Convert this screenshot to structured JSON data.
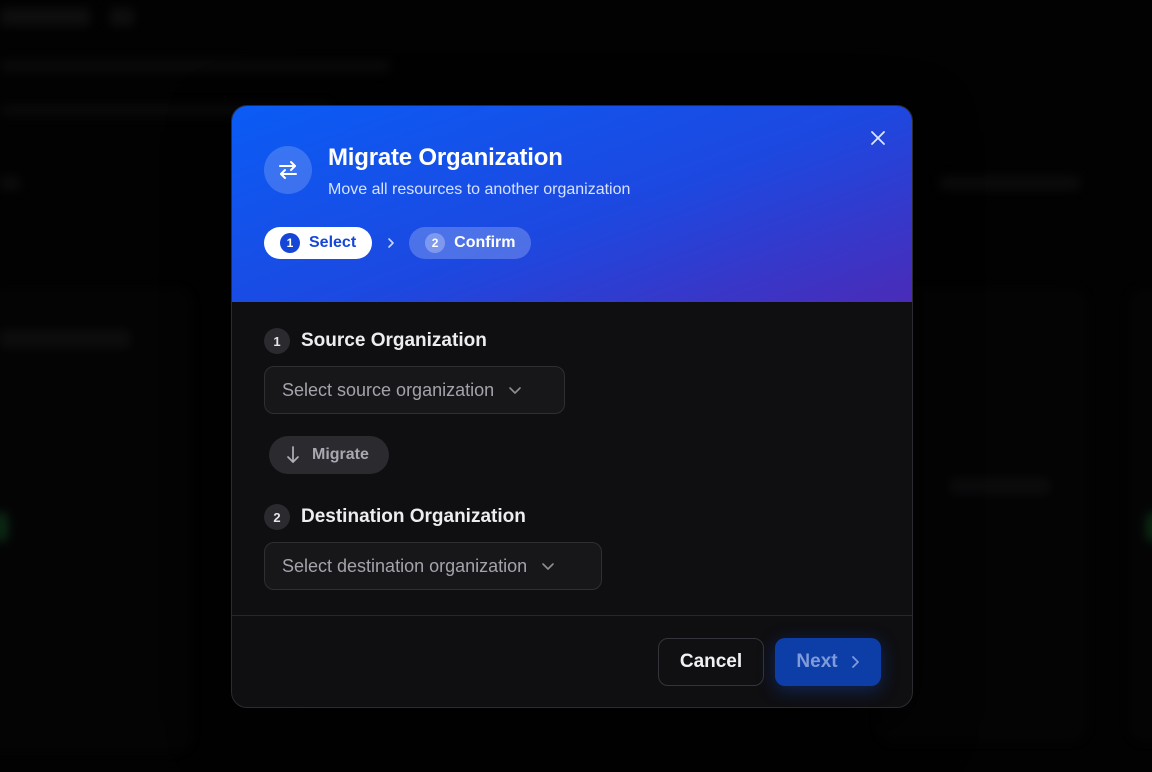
{
  "dialog": {
    "title": "Migrate Organization",
    "subtitle": "Move all resources to another organization",
    "header_icon": "swap-arrows-icon",
    "close_icon": "close-icon",
    "steps": [
      {
        "number": "1",
        "label": "Select",
        "state": "active"
      },
      {
        "number": "2",
        "label": "Confirm",
        "state": "inactive"
      }
    ],
    "source": {
      "number": "1",
      "label": "Source Organization",
      "placeholder": "Select source organization"
    },
    "migrate_label": "Migrate",
    "destination": {
      "number": "2",
      "label": "Destination Organization",
      "placeholder": "Select destination organization"
    },
    "footer": {
      "cancel_label": "Cancel",
      "next_label": "Next"
    }
  },
  "colors": {
    "accent": "#0a5cf5",
    "header_gradient_end": "#4a2bb8",
    "next_button": "#0d3ea8",
    "background": "#050505"
  }
}
